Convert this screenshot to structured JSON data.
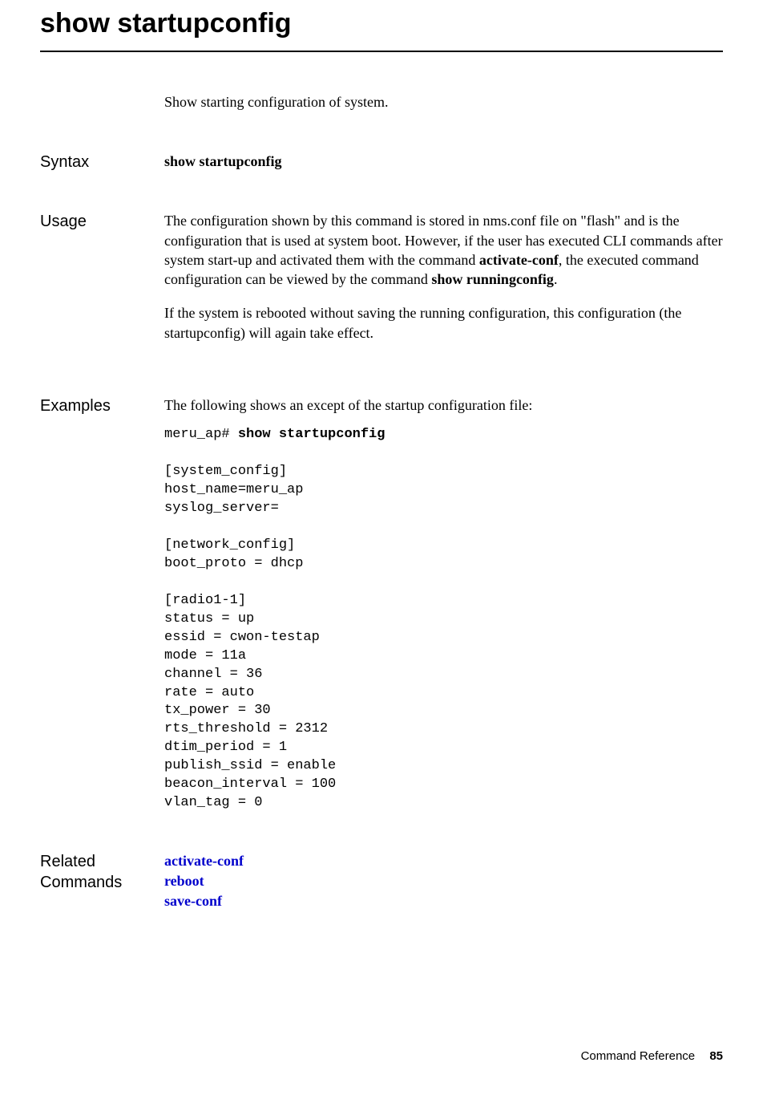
{
  "title": "show startupconfig",
  "description": "Show starting configuration of system.",
  "syntax": {
    "label": "Syntax",
    "command": "show startupconfig"
  },
  "usage": {
    "label": "Usage",
    "para1_before": "The configuration shown by this command is stored in nms.conf file on \"flash\" and is the configuration that is used at system boot. However, if the user has executed CLI commands after system start-up and activated them with the command ",
    "para1_bold1": "activate-conf",
    "para1_mid": ", the executed command configuration can be viewed by the command ",
    "para1_bold2": "show runningconfig",
    "para1_after": ".",
    "para2": "If the system is rebooted without saving the running configuration, this configuration (the startupconfig) will again take effect."
  },
  "examples": {
    "label": "Examples",
    "intro": "The following shows an except of the startup configuration file:",
    "prompt": "meru_ap# ",
    "command": "show startupconfig",
    "output": "[system_config]\nhost_name=meru_ap\nsyslog_server=\n\n[network_config]\nboot_proto = dhcp\n\n[radio1-1]\nstatus = up\nessid = cwon-testap\nmode = 11a\nchannel = 36\nrate = auto\ntx_power = 30\nrts_threshold = 2312\ndtim_period = 1\npublish_ssid = enable\nbeacon_interval = 100\nvlan_tag = 0"
  },
  "related": {
    "label": "Related Commands",
    "links": [
      "activate-conf",
      "reboot",
      "save-conf"
    ]
  },
  "footer": {
    "text": "Command Reference",
    "page": "85"
  }
}
